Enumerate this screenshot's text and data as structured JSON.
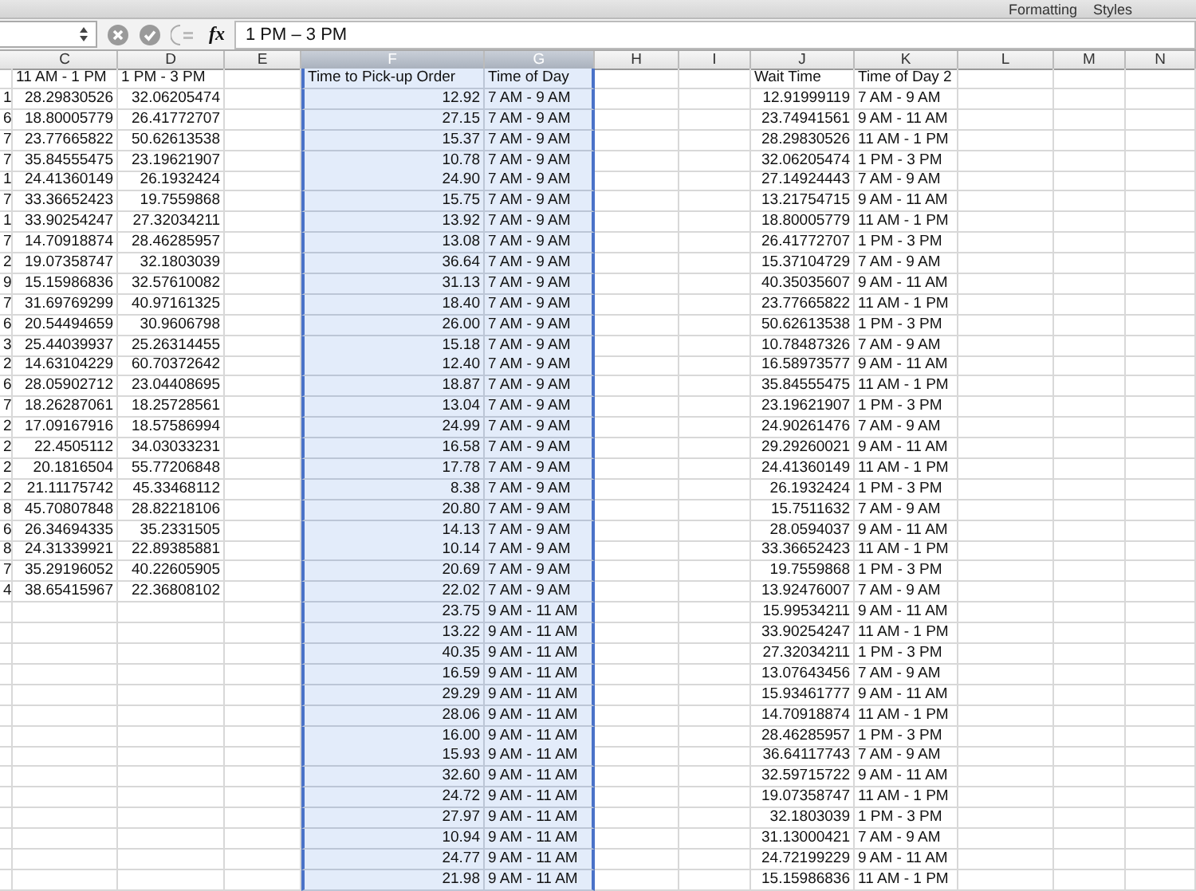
{
  "ribbon_labels": [
    "Formatting",
    "Styles"
  ],
  "formula_bar": {
    "fx_label": "fx",
    "value": "1 PM – 3 PM"
  },
  "columns": [
    {
      "letter": "C",
      "selected": false
    },
    {
      "letter": "D",
      "selected": false
    },
    {
      "letter": "E",
      "selected": false
    },
    {
      "letter": "F",
      "selected": true
    },
    {
      "letter": "G",
      "selected": true
    },
    {
      "letter": "H",
      "selected": false
    },
    {
      "letter": "I",
      "selected": false
    },
    {
      "letter": "J",
      "selected": false
    },
    {
      "letter": "K",
      "selected": false
    },
    {
      "letter": "L",
      "selected": false
    },
    {
      "letter": "M",
      "selected": false
    },
    {
      "letter": "N",
      "selected": false
    }
  ],
  "rows": [
    {
      "kind": "header",
      "C": "11 AM - 1 PM",
      "D": "1 PM - 3 PM",
      "F": "Time to Pick-up Order",
      "G": "Time of Day",
      "J": "Wait Time",
      "K": "Time of Day 2"
    },
    {
      "kind": "data",
      "B": "1",
      "C": "28.29830526",
      "D": "32.06205474",
      "F": "12.92",
      "G": "7 AM - 9 AM",
      "J": "12.91999119",
      "K": "7 AM - 9 AM"
    },
    {
      "kind": "data",
      "B": "6",
      "C": "18.80005779",
      "D": "26.41772707",
      "F": "27.15",
      "G": "7 AM - 9 AM",
      "J": "23.74941561",
      "K": "9 AM - 11 AM"
    },
    {
      "kind": "data",
      "B": "7",
      "C": "23.77665822",
      "D": "50.62613538",
      "F": "15.37",
      "G": "7 AM - 9 AM",
      "J": "28.29830526",
      "K": "11 AM - 1 PM"
    },
    {
      "kind": "data",
      "B": "7",
      "C": "35.84555475",
      "D": "23.19621907",
      "F": "10.78",
      "G": "7 AM - 9 AM",
      "J": "32.06205474",
      "K": "1 PM - 3 PM"
    },
    {
      "kind": "data",
      "B": "1",
      "C": "24.41360149",
      "D": "26.1932424",
      "F": "24.90",
      "G": "7 AM - 9 AM",
      "J": "27.14924443",
      "K": "7 AM - 9 AM"
    },
    {
      "kind": "data",
      "B": "7",
      "C": "33.36652423",
      "D": "19.7559868",
      "F": "15.75",
      "G": "7 AM - 9 AM",
      "J": "13.21754715",
      "K": "9 AM - 11 AM"
    },
    {
      "kind": "data",
      "B": "1",
      "C": "33.90254247",
      "D": "27.32034211",
      "F": "13.92",
      "G": "7 AM - 9 AM",
      "J": "18.80005779",
      "K": "11 AM - 1 PM"
    },
    {
      "kind": "data",
      "B": "7",
      "C": "14.70918874",
      "D": "28.46285957",
      "F": "13.08",
      "G": "7 AM - 9 AM",
      "J": "26.41772707",
      "K": "1 PM - 3 PM"
    },
    {
      "kind": "data",
      "B": "2",
      "C": "19.07358747",
      "D": "32.1803039",
      "F": "36.64",
      "G": "7 AM - 9 AM",
      "J": "15.37104729",
      "K": "7 AM - 9 AM"
    },
    {
      "kind": "data",
      "B": "9",
      "C": "15.15986836",
      "D": "32.57610082",
      "F": "31.13",
      "G": "7 AM - 9 AM",
      "J": "40.35035607",
      "K": "9 AM - 11 AM"
    },
    {
      "kind": "data",
      "B": "7",
      "C": "31.69769299",
      "D": "40.97161325",
      "F": "18.40",
      "G": "7 AM - 9 AM",
      "J": "23.77665822",
      "K": "11 AM - 1 PM"
    },
    {
      "kind": "data",
      "B": "6",
      "C": "20.54494659",
      "D": "30.9606798",
      "F": "26.00",
      "G": "7 AM - 9 AM",
      "J": "50.62613538",
      "K": "1 PM - 3 PM"
    },
    {
      "kind": "data",
      "B": "3",
      "C": "25.44039937",
      "D": "25.26314455",
      "F": "15.18",
      "G": "7 AM - 9 AM",
      "J": "10.78487326",
      "K": "7 AM - 9 AM"
    },
    {
      "kind": "data",
      "B": "2",
      "C": "14.63104229",
      "D": "60.70372642",
      "F": "12.40",
      "G": "7 AM - 9 AM",
      "J": "16.58973577",
      "K": "9 AM - 11 AM"
    },
    {
      "kind": "data",
      "B": "6",
      "C": "28.05902712",
      "D": "23.04408695",
      "F": "18.87",
      "G": "7 AM - 9 AM",
      "J": "35.84555475",
      "K": "11 AM - 1 PM"
    },
    {
      "kind": "data",
      "B": "7",
      "C": "18.26287061",
      "D": "18.25728561",
      "F": "13.04",
      "G": "7 AM - 9 AM",
      "J": "23.19621907",
      "K": "1 PM - 3 PM"
    },
    {
      "kind": "data",
      "B": "2",
      "C": "17.09167916",
      "D": "18.57586994",
      "F": "24.99",
      "G": "7 AM - 9 AM",
      "J": "24.90261476",
      "K": "7 AM - 9 AM"
    },
    {
      "kind": "data",
      "B": "2",
      "C": "22.4505112",
      "D": "34.03033231",
      "F": "16.58",
      "G": "7 AM - 9 AM",
      "J": "29.29260021",
      "K": "9 AM - 11 AM"
    },
    {
      "kind": "data",
      "B": "2",
      "C": "20.1816504",
      "D": "55.77206848",
      "F": "17.78",
      "G": "7 AM - 9 AM",
      "J": "24.41360149",
      "K": "11 AM - 1 PM"
    },
    {
      "kind": "data",
      "B": "2",
      "C": "21.11175742",
      "D": "45.33468112",
      "F": "8.38",
      "G": "7 AM - 9 AM",
      "J": "26.1932424",
      "K": "1 PM - 3 PM"
    },
    {
      "kind": "data",
      "B": "8",
      "C": "45.70807848",
      "D": "28.82218106",
      "F": "20.80",
      "G": "7 AM - 9 AM",
      "J": "15.7511632",
      "K": "7 AM - 9 AM"
    },
    {
      "kind": "data",
      "B": "6",
      "C": "26.34694335",
      "D": "35.2331505",
      "F": "14.13",
      "G": "7 AM - 9 AM",
      "J": "28.0594037",
      "K": "9 AM - 11 AM"
    },
    {
      "kind": "data",
      "B": "8",
      "C": "24.31339921",
      "D": "22.89385881",
      "F": "10.14",
      "G": "7 AM - 9 AM",
      "J": "33.36652423",
      "K": "11 AM - 1 PM"
    },
    {
      "kind": "data",
      "B": "7",
      "C": "35.29196052",
      "D": "40.22605905",
      "F": "20.69",
      "G": "7 AM - 9 AM",
      "J": "19.7559868",
      "K": "1 PM - 3 PM"
    },
    {
      "kind": "data",
      "B": "4",
      "C": "38.65415967",
      "D": "22.36808102",
      "F": "22.02",
      "G": "7 AM - 9 AM",
      "J": "13.92476007",
      "K": "7 AM - 9 AM"
    },
    {
      "kind": "data",
      "F": "23.75",
      "G": "9 AM - 11 AM",
      "J": "15.99534211",
      "K": "9 AM - 11 AM"
    },
    {
      "kind": "data",
      "F": "13.22",
      "G": "9 AM - 11 AM",
      "J": "33.90254247",
      "K": "11 AM - 1 PM"
    },
    {
      "kind": "data",
      "F": "40.35",
      "G": "9 AM - 11 AM",
      "J": "27.32034211",
      "K": "1 PM - 3 PM"
    },
    {
      "kind": "data",
      "F": "16.59",
      "G": "9 AM - 11 AM",
      "J": "13.07643456",
      "K": "7 AM - 9 AM"
    },
    {
      "kind": "data",
      "F": "29.29",
      "G": "9 AM - 11 AM",
      "J": "15.93461777",
      "K": "9 AM - 11 AM"
    },
    {
      "kind": "data",
      "F": "28.06",
      "G": "9 AM - 11 AM",
      "J": "14.70918874",
      "K": "11 AM - 1 PM"
    },
    {
      "kind": "data",
      "F": "16.00",
      "G": "9 AM - 11 AM",
      "J": "28.46285957",
      "K": "1 PM - 3 PM"
    },
    {
      "kind": "data",
      "F": "15.93",
      "G": "9 AM - 11 AM",
      "J": "36.64117743",
      "K": "7 AM - 9 AM"
    },
    {
      "kind": "data",
      "F": "32.60",
      "G": "9 AM - 11 AM",
      "J": "32.59715722",
      "K": "9 AM - 11 AM"
    },
    {
      "kind": "data",
      "F": "24.72",
      "G": "9 AM - 11 AM",
      "J": "19.07358747",
      "K": "11 AM - 1 PM"
    },
    {
      "kind": "data",
      "F": "27.97",
      "G": "9 AM - 11 AM",
      "J": "32.1803039",
      "K": "1 PM - 3 PM"
    },
    {
      "kind": "data",
      "F": "10.94",
      "G": "9 AM - 11 AM",
      "J": "31.13000421",
      "K": "7 AM - 9 AM"
    },
    {
      "kind": "data",
      "F": "24.77",
      "G": "9 AM - 11 AM",
      "J": "24.72199229",
      "K": "9 AM - 11 AM"
    },
    {
      "kind": "data",
      "F": "21.98",
      "G": "9 AM - 11 AM",
      "J": "15.15986836",
      "K": "11 AM - 1 PM"
    }
  ]
}
